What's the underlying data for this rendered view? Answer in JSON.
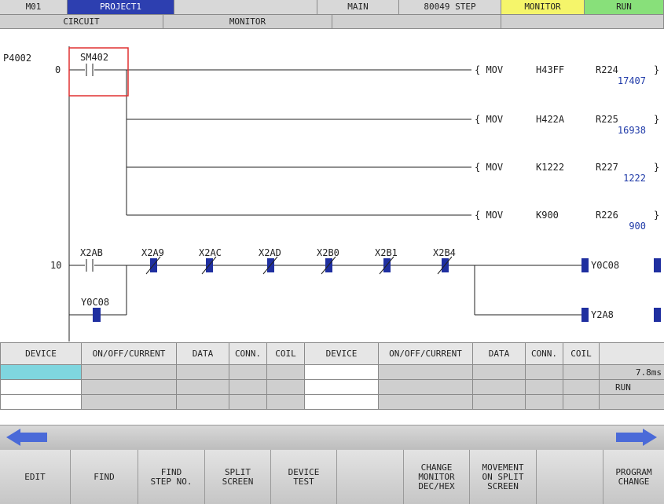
{
  "header": {
    "machine": "M01",
    "project": "PROJECT1",
    "program": "MAIN",
    "steps": "80049 STEP",
    "mode": "MONITOR",
    "state": "RUN"
  },
  "subheader": {
    "left": "CIRCUIT",
    "mid": "MONITOR"
  },
  "ladder": {
    "pointer": "P4002",
    "step0": "0",
    "step10": "10",
    "contact_sm": "SM402",
    "movs": [
      {
        "inst": "{ MOV",
        "src": "H43FF",
        "dst": "R224",
        "val": "17407"
      },
      {
        "inst": "{ MOV",
        "src": "H422A",
        "dst": "R225",
        "val": "16938"
      },
      {
        "inst": "{ MOV",
        "src": "K1222",
        "dst": "R227",
        "val": "1222"
      },
      {
        "inst": "{ MOV",
        "src": "K900",
        "dst": "R226",
        "val": "900"
      }
    ],
    "contacts2": [
      "X2AB",
      "X2A9",
      "X2AC",
      "X2AD",
      "X2B0",
      "X2B1",
      "X2B4"
    ],
    "branch_contact": "Y0C08",
    "coil1": "Y0C08",
    "coil2": "Y2A8",
    "bracket": "}"
  },
  "table": {
    "headers": [
      "DEVICE",
      "ON/OFF/CURRENT",
      "DATA",
      "CONN.",
      "COIL",
      "DEVICE",
      "ON/OFF/CURRENT",
      "DATA",
      "CONN.",
      "COIL"
    ],
    "scan_time": "7.8ms",
    "status": "RUN"
  },
  "nav": {
    "left_arrow": "previous-arrow-icon",
    "right_arrow": "next-arrow-icon"
  },
  "keys": [
    "EDIT",
    "FIND",
    "FIND\nSTEP NO.",
    "SPLIT\nSCREEN",
    "DEVICE\nTEST",
    "",
    "CHANGE\nMONITOR\nDEC/HEX",
    "MOVEMENT\nON SPLIT\nSCREEN",
    "",
    "PROGRAM\nCHANGE"
  ],
  "colors": {
    "header_blue": "#2d3fb0",
    "monitor_yellow": "#f5f56a",
    "run_green": "#88e07a",
    "contact_blue": "#1f2fa0",
    "cursor_red": "#e03030",
    "row_cyan": "#7fd6df",
    "arrow_blue": "#4a6ad8"
  }
}
